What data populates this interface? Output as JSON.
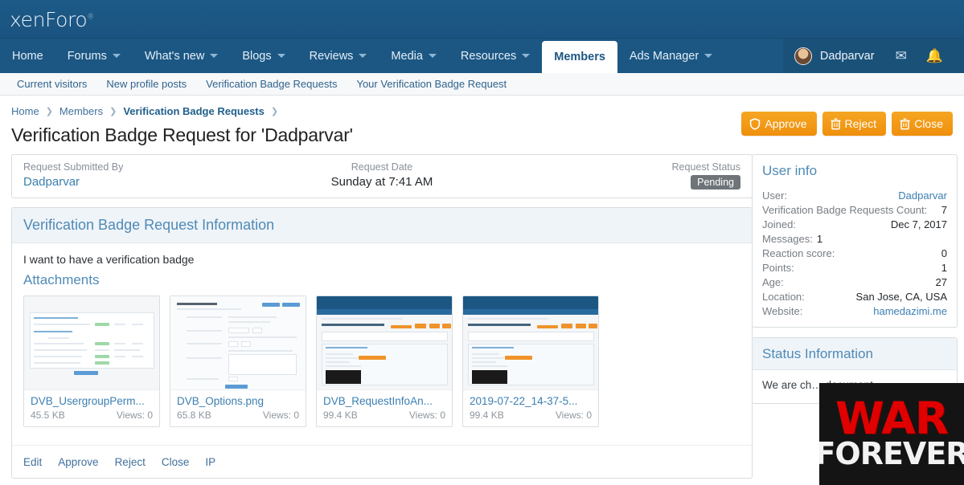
{
  "header": {
    "logo_text": "xenForo",
    "logo_reg": "®"
  },
  "nav": {
    "items": [
      {
        "label": "Home",
        "caret": false,
        "active": false
      },
      {
        "label": "Forums",
        "caret": true,
        "active": false
      },
      {
        "label": "What's new",
        "caret": true,
        "active": false
      },
      {
        "label": "Blogs",
        "caret": true,
        "active": false
      },
      {
        "label": "Reviews",
        "caret": true,
        "active": false
      },
      {
        "label": "Media",
        "caret": true,
        "active": false
      },
      {
        "label": "Resources",
        "caret": true,
        "active": false
      },
      {
        "label": "Members",
        "caret": false,
        "active": true
      },
      {
        "label": "Ads Manager",
        "caret": true,
        "active": false
      }
    ],
    "user": {
      "name": "Dadparvar",
      "avatar_icon": "user-avatar",
      "mail_icon": "✉",
      "bell_icon": "🔔"
    }
  },
  "subnav": {
    "items": [
      "Current visitors",
      "New profile posts",
      "Verification Badge Requests",
      "Your Verification Badge Request"
    ]
  },
  "breadcrumb": {
    "items": [
      "Home",
      "Members",
      "Verification Badge Requests"
    ]
  },
  "page": {
    "title": "Verification Badge Request for 'Dadparvar'"
  },
  "actions": {
    "approve": {
      "label": "Approve",
      "icon": "shield-icon"
    },
    "reject": {
      "label": "Reject",
      "icon": "trash-icon"
    },
    "close": {
      "label": "Close",
      "icon": "trash-icon"
    },
    "color": "#ef8f0c"
  },
  "info_strip": {
    "submitted_by_label": "Request Submitted By",
    "submitted_by_value": "Dadparvar",
    "request_date_label": "Request Date",
    "request_date_value": "Sunday at 7:41 AM",
    "request_status_label": "Request Status",
    "request_status_value": "Pending"
  },
  "main": {
    "panel_title": "Verification Badge Request Information",
    "request_text": "I want to have a verification badge",
    "attachments_title": "Attachments",
    "attachments": [
      {
        "name": "DVB_UsergroupPerm...",
        "size": "45.5 KB",
        "views": "Views: 0"
      },
      {
        "name": "DVB_Options.png",
        "size": "65.8 KB",
        "views": "Views: 0"
      },
      {
        "name": "DVB_RequestInfoAn...",
        "size": "99.4 KB",
        "views": "Views: 0"
      },
      {
        "name": "2019-07-22_14-37-5...",
        "size": "99.4 KB",
        "views": "Views: 0"
      }
    ],
    "footer_links": [
      "Edit",
      "Approve",
      "Reject",
      "Close",
      "IP"
    ]
  },
  "sidebar": {
    "user_info": {
      "title": "User info",
      "rows": [
        {
          "key": "User:",
          "value": "Dadparvar",
          "link": true
        },
        {
          "key": "Verification Badge Requests Count:",
          "value": "7",
          "link": false
        },
        {
          "key": "Joined:",
          "value": "Dec 7, 2017",
          "link": false
        },
        {
          "key": "Messages:",
          "value": "1",
          "link": false,
          "inline": true
        },
        {
          "key": "Reaction score:",
          "value": "0",
          "link": false
        },
        {
          "key": "Points:",
          "value": "1",
          "link": false
        },
        {
          "key": "Age:",
          "value": "27",
          "link": false
        },
        {
          "key": "Location:",
          "value": "San Jose, CA, USA",
          "link": false
        },
        {
          "key": "Website:",
          "value": "hamedazimi.me",
          "link": true
        }
      ]
    },
    "status_info": {
      "title": "Status Information",
      "text": "We are ch… document…"
    }
  },
  "overlay": {
    "line1": "WAR",
    "line2": "FOREVER"
  }
}
